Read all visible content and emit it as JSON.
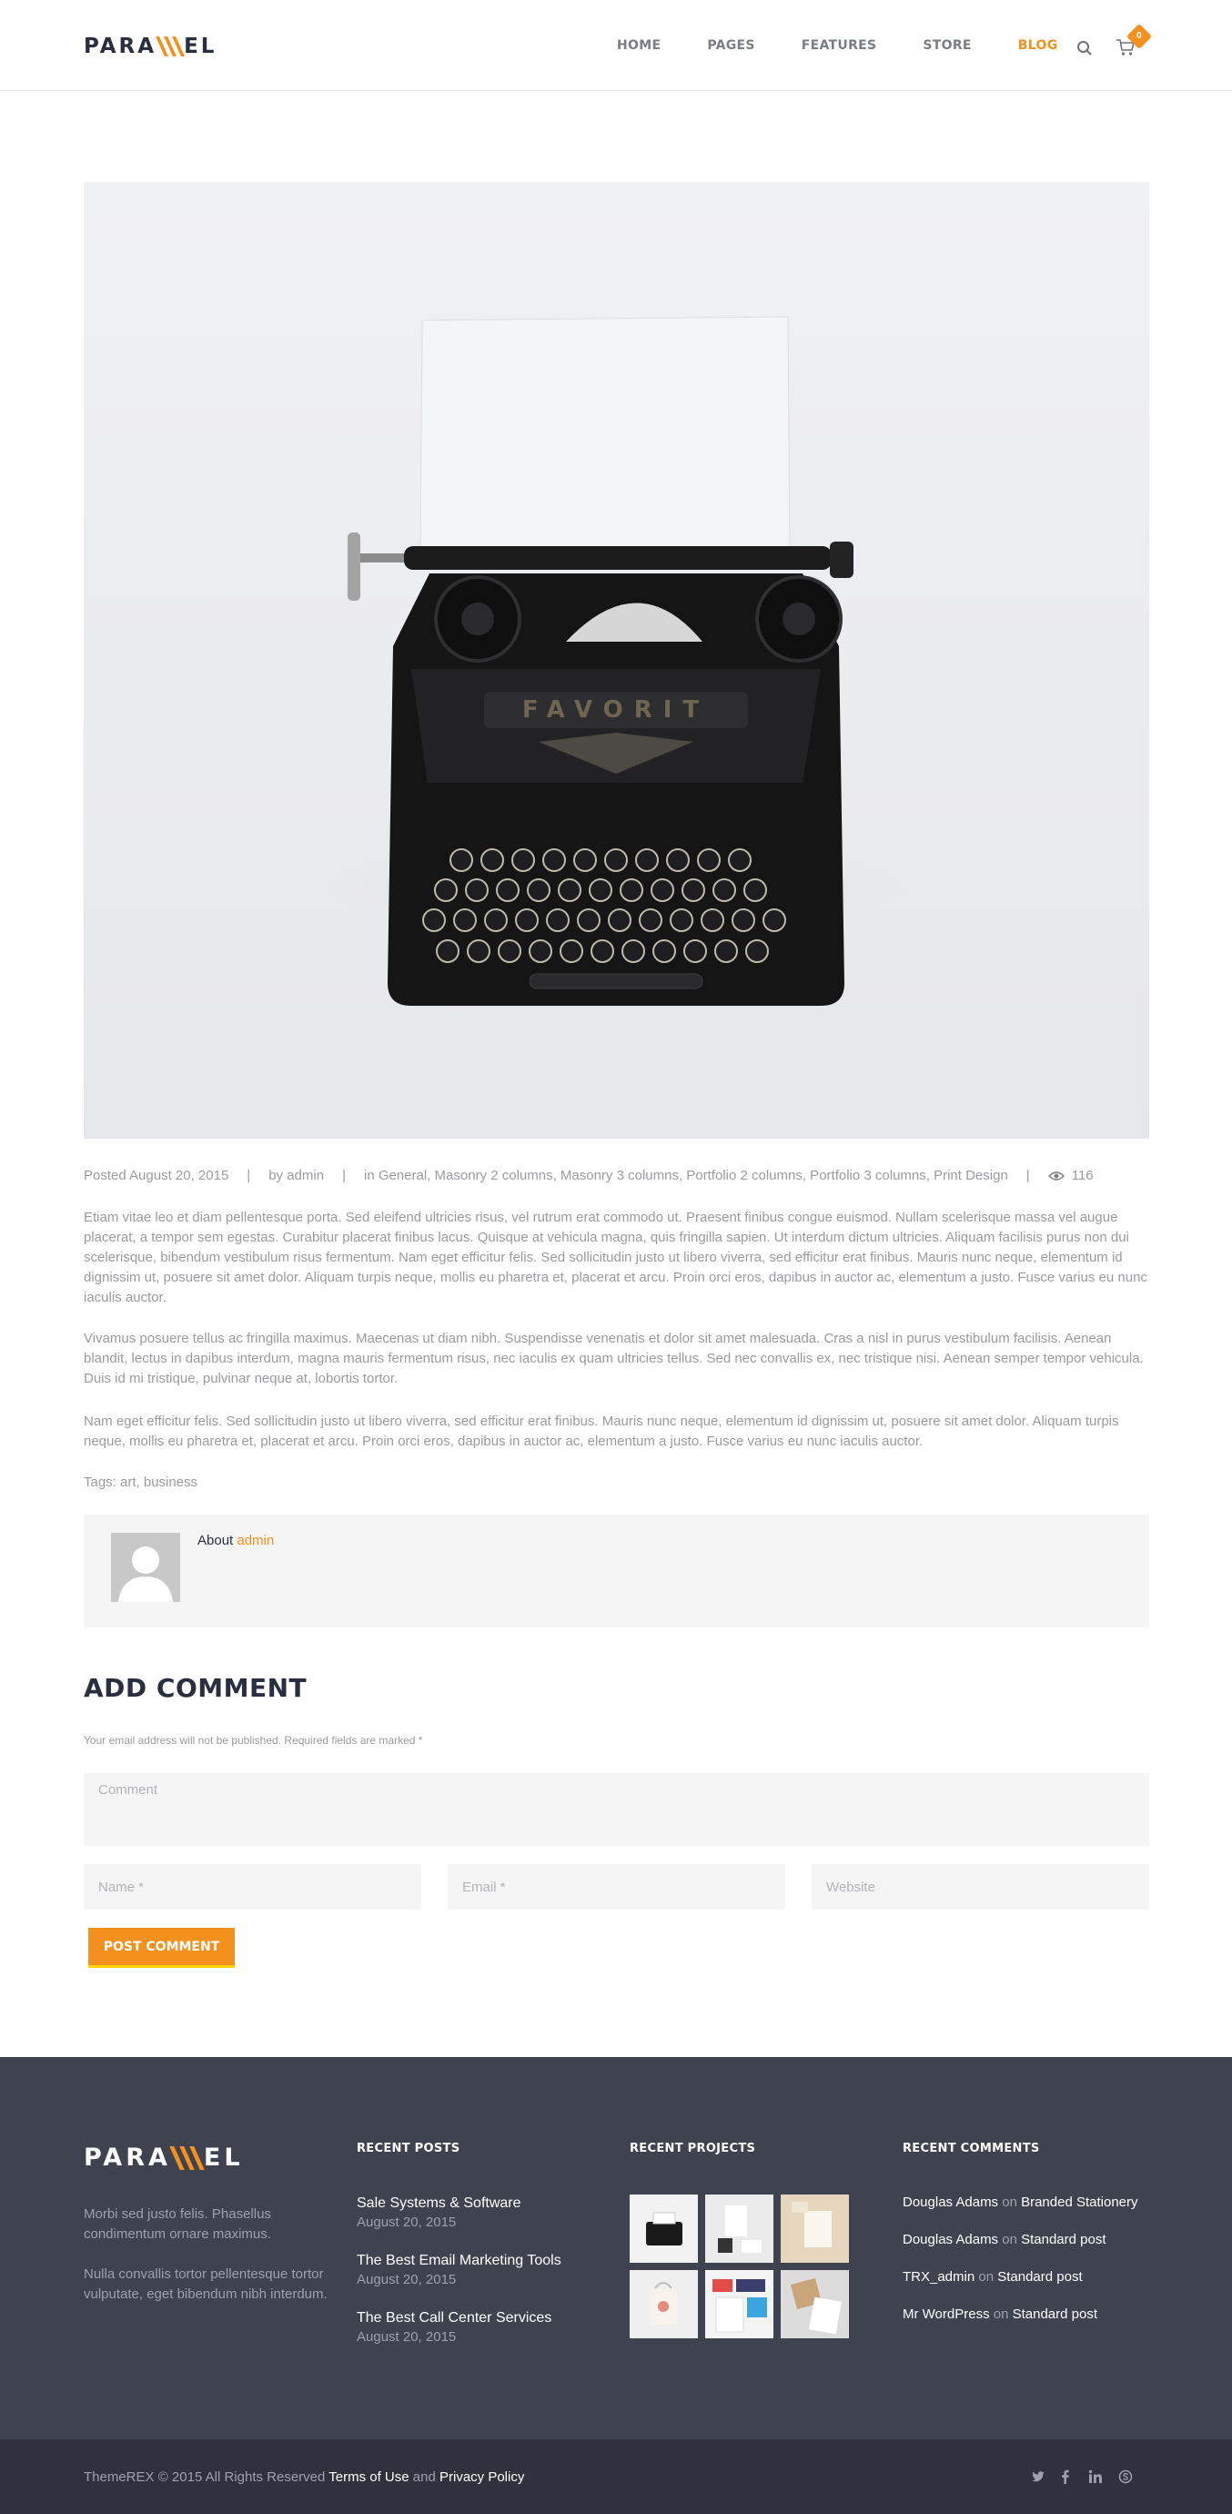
{
  "header": {
    "logo": "PARA\\\\EL",
    "nav": [
      "HOME",
      "PAGES",
      "FEATURES",
      "STORE",
      "BLOG"
    ],
    "active_nav": "BLOG",
    "cart_count": "0"
  },
  "post": {
    "meta": {
      "posted": "Posted August 20, 2015",
      "by": "by admin",
      "categories": "in General, Masonry 2 columns, Masonry 3 columns, Portfolio 2 columns, Portfolio 3 columns, Print Design",
      "views": "116"
    },
    "paragraphs": [
      "Etiam vitae leo et diam pellentesque porta. Sed eleifend ultricies risus, vel rutrum erat commodo ut. Praesent finibus congue euismod. Nullam scelerisque massa vel augue placerat, a tempor sem egestas. Curabitur placerat finibus lacus. Quisque at vehicula magna, quis fringilla sapien. Ut interdum dictum ultricies. Aliquam facilisis purus non dui scelerisque, bibendum vestibulum risus fermentum. Nam eget efficitur felis. Sed sollicitudin justo ut libero viverra, sed efficitur erat finibus. Mauris nunc neque, elementum id dignissim ut, posuere sit amet dolor. Aliquam turpis neque, mollis eu pharetra et, placerat et arcu. Proin orci eros, dapibus in auctor ac, elementum a justo. Fusce varius eu nunc iaculis auctor.",
      "Vivamus posuere tellus ac fringilla maximus. Maecenas ut diam nibh. Suspendisse venenatis et dolor sit amet malesuada. Cras a nisl in purus vestibulum facilisis. Aenean blandit, lectus in dapibus interdum, magna mauris fermentum risus, nec iaculis ex quam ultricies tellus. Sed nec convallis ex, nec tristique nisi. Aenean semper tempor vehicula. Duis id mi tristique, pulvinar neque at, lobortis tortor.",
      "Nam eget efficitur felis. Sed sollicitudin justo ut libero viverra, sed efficitur erat finibus. Mauris nunc neque, elementum id dignissim ut, posuere sit amet dolor. Aliquam turpis neque, mollis eu pharetra et, placerat et arcu. Proin orci eros, dapibus in auctor ac, elementum a justo. Fusce varius eu nunc iaculis auctor."
    ],
    "tags": "Tags: art, business",
    "author_about": "About ",
    "author_name": "admin"
  },
  "comment_form": {
    "title": "ADD COMMENT",
    "note": "Your email address will not be published. Required fields are marked *",
    "comment_placeholder": "Comment",
    "name_placeholder": "Name *",
    "email_placeholder": "Email *",
    "website_placeholder": "Website",
    "submit_label": "POST COMMENT"
  },
  "footer": {
    "logo": "PARA\\\\EL",
    "about": [
      "Morbi sed justo felis. Phasellus condimentum ornare maximus.",
      "Nulla convallis tortor pellentesque tortor vulputate, eget bibendum nibh interdum."
    ],
    "recent_posts_title": "RECENT POSTS",
    "recent_posts": [
      {
        "title": "Sale Systems & Software",
        "date": "August 20, 2015"
      },
      {
        "title": "The Best Email Marketing Tools",
        "date": "August 20, 2015"
      },
      {
        "title": "The Best Call Center Services",
        "date": "August 20, 2015"
      }
    ],
    "recent_projects_title": "RECENT PROJECTS",
    "recent_comments_title": "RECENT COMMENTS",
    "recent_comments": [
      {
        "author": "Douglas Adams",
        "on": " on ",
        "post": "Branded Stationery"
      },
      {
        "author": "Douglas Adams",
        "on": " on ",
        "post": "Standard post"
      },
      {
        "author": "TRX_admin",
        "on": " on ",
        "post": "Standard post"
      },
      {
        "author": "Mr WordPress",
        "on": " on ",
        "post": "Standard post"
      }
    ]
  },
  "bottom_bar": {
    "brand": "ThemeREX",
    "copyright": " © 2015 All Rights Reserved ",
    "terms": "Terms of Use",
    "and": " and ",
    "privacy": "Privacy Policy",
    "social": [
      "twitter-icon",
      "facebook-icon",
      "linkedin-icon",
      "skype-icon"
    ]
  },
  "colors": {
    "accent": "#f4901e",
    "dark": "#2b2e3e",
    "footer": "#3f424f",
    "footer_bottom": "#2f323c"
  }
}
